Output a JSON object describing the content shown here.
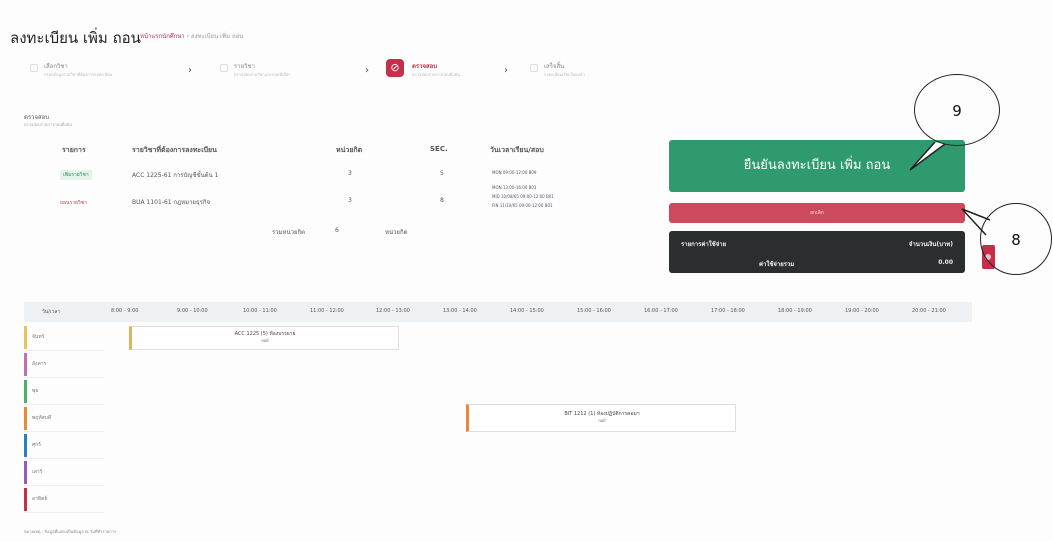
{
  "header": {
    "title": "ลงทะเบียน เพิ่ม ถอน",
    "breadcrumb_link": "หน้าแรกนักศึกษา",
    "breadcrumb_sep": "›",
    "breadcrumb_current": "ลงทะเบียน เพิ่ม ถอน"
  },
  "stepper": {
    "steps": [
      {
        "label": "เลือกวิชา",
        "sub": "กรอกข้อมูลรายวิชาที่ต้องการลงทะเบียน"
      },
      {
        "label": "รายวิชา",
        "sub": "ตรวจสอบรายวิชาและกลุ่มที่เลือก"
      },
      {
        "label": "ตรวจสอบ",
        "sub": "ตรวจสอบรายการก่อนยืนยัน"
      },
      {
        "label": "เสร็จสิ้น",
        "sub": "ลงทะเบียนเรียบร้อยแล้ว"
      }
    ],
    "arrow": "›",
    "active_icon": "⊘"
  },
  "section": {
    "label": "ตรวจสอบ",
    "sub": "ตรวจสอบรายการก่อนยืนยัน"
  },
  "courses": {
    "headers": {
      "type": "รายการ",
      "course": "รายวิชาที่ต้องการลงทะเบียน",
      "credit": "หน่วยกิต",
      "sec": "SEC.",
      "time": "วันเวลาเรียน/สอบ"
    },
    "rows": [
      {
        "type": "เพิ่มรายวิชา",
        "course": "ACC 1225-61  การบัญชีขั้นต้น 1",
        "credit": "3",
        "sec": "5",
        "time1": "MON 09:00-12:00 B09",
        "time2": ""
      },
      {
        "type": "ถอนรายวิชา",
        "course": "BUA 1101-61  กฎหมายธุรกิจ",
        "credit": "3",
        "sec": "8",
        "time1": "MON 13:00-16:00 B03",
        "time2": "MID 10/08/65 09:00-12:00 B01",
        "time3": "FIN 11/10/65 09:00-12:00 B01"
      }
    ],
    "total_label": "รวมหน่วยกิต",
    "total_value": "6",
    "total_unit": "หน่วยกิต"
  },
  "actions": {
    "confirm": "ยืนยันลงทะเบียน เพิ่ม ถอน",
    "cancel": "ยกเลิก"
  },
  "cost": {
    "col1": "รายการค่าใช้จ่าย",
    "col2": "จำนวนเงิน(บาท)",
    "row_label": "ค่าใช้จ่ายรวม",
    "row_value": "0.00"
  },
  "callouts": {
    "c9": "9",
    "c8": "8"
  },
  "schedule": {
    "day_header": "วัน/เวลา",
    "times": [
      "8:00 - 9:00",
      "9:00 - 10:00",
      "10:00 - 11:00",
      "11:00 - 12:00",
      "12:00 - 13:00",
      "13:00 - 14:00",
      "14:00 - 15:00",
      "15:00 - 16:00",
      "16:00 - 17:00",
      "17:00 - 18:00",
      "18:00 - 19:00",
      "19:00 - 20:00",
      "20:00 - 21:00"
    ],
    "days": [
      {
        "label": "จันทร์",
        "color": "#e8c35a"
      },
      {
        "label": "อังคาร",
        "color": "#c070b0"
      },
      {
        "label": "พุธ",
        "color": "#4caf6a"
      },
      {
        "label": "พฤหัสบดี",
        "color": "#e8893a"
      },
      {
        "label": "ศุกร์",
        "color": "#2a7fc0"
      },
      {
        "label": "เสาร์",
        "color": "#9b59b6"
      },
      {
        "label": "อาทิตย์",
        "color": "#c62f4a"
      }
    ],
    "blocks": [
      {
        "title": "ACC 1225 (5) ห้องบรรยาย",
        "room": "null"
      },
      {
        "title": "BIT 1212 (1) ห้องปฏิบัติการคอมฯ",
        "room": "null"
      }
    ]
  },
  "footer": "หมายเหตุ : ข้อมูลที่แสดงเป็นข้อมูล ณ วันที่ทำรายการ"
}
